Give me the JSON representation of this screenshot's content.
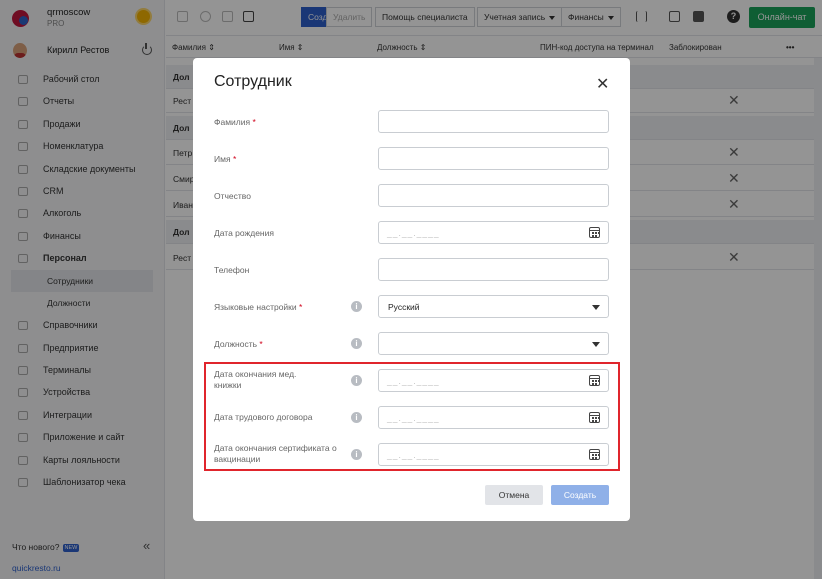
{
  "brand": {
    "name": "qrmoscow",
    "plan": "PRO"
  },
  "user": {
    "name": "Кирилл Рестов"
  },
  "sidebar": {
    "items": [
      {
        "label": "Рабочий стол"
      },
      {
        "label": "Отчеты"
      },
      {
        "label": "Продажи"
      },
      {
        "label": "Номенклатура"
      },
      {
        "label": "Складские документы"
      },
      {
        "label": "CRM"
      },
      {
        "label": "Алкоголь"
      },
      {
        "label": "Финансы"
      },
      {
        "label": "Персонал"
      },
      {
        "label": "Сотрудники"
      },
      {
        "label": "Должности"
      },
      {
        "label": "Справочники"
      },
      {
        "label": "Предприятие"
      },
      {
        "label": "Терминалы"
      },
      {
        "label": "Устройства"
      },
      {
        "label": "Интеграции"
      },
      {
        "label": "Приложение и сайт"
      },
      {
        "label": "Карты лояльности"
      },
      {
        "label": "Шаблонизатор чека"
      }
    ],
    "news_label": "Что нового?",
    "news_badge": "NEW",
    "collapse_icon": "«",
    "site_link": "quickresto.ru"
  },
  "toolbar": {
    "create": "Создать",
    "delete": "Удалить",
    "specialist": "Помощь специалиста",
    "account": "Учетная запись",
    "finance": "Финансы",
    "help": "?",
    "chat": "Онлайн-чат"
  },
  "table": {
    "headers": [
      "Фамилия ⇕",
      "Имя ⇕",
      "Должность ⇕",
      "ПИН-код доступа на терминал",
      "Заблокирован",
      "•••"
    ],
    "rows": [
      {
        "text": "Дол",
        "group": true,
        "blocked": ""
      },
      {
        "text": "Рест",
        "group": false,
        "blocked": "✕"
      },
      {
        "text": "Дол",
        "group": true,
        "blocked": ""
      },
      {
        "text": "Петр",
        "group": false,
        "blocked": "✕"
      },
      {
        "text": "Смир",
        "group": false,
        "blocked": "✕"
      },
      {
        "text": "Иван",
        "group": false,
        "blocked": "✕"
      },
      {
        "text": "Дол",
        "group": true,
        "blocked": ""
      },
      {
        "text": "Рест",
        "group": false,
        "blocked": "✕"
      }
    ]
  },
  "modal": {
    "title": "Сотрудник",
    "close": "✕",
    "fields": {
      "last_name": {
        "label": "Фамилия",
        "required": "*"
      },
      "first_name": {
        "label": "Имя",
        "required": "*"
      },
      "patronymic": {
        "label": "Отчество"
      },
      "birth_date": {
        "label": "Дата рождения",
        "placeholder": "__.__.____"
      },
      "phone": {
        "label": "Телефон"
      },
      "language": {
        "label": "Языковые настройки",
        "required": "*",
        "value": "Русский"
      },
      "position": {
        "label": "Должность",
        "required": "*",
        "value": ""
      },
      "med_book": {
        "label": "Дата окончания мед. книжки",
        "placeholder": "__.__.____"
      },
      "contract": {
        "label": "Дата трудового договора",
        "placeholder": "__.__.____"
      },
      "vaccine": {
        "label": "Дата окончания сертификата о вакцинации",
        "placeholder": "__.__.____"
      }
    },
    "cancel": "Отмена",
    "submit": "Создать"
  }
}
